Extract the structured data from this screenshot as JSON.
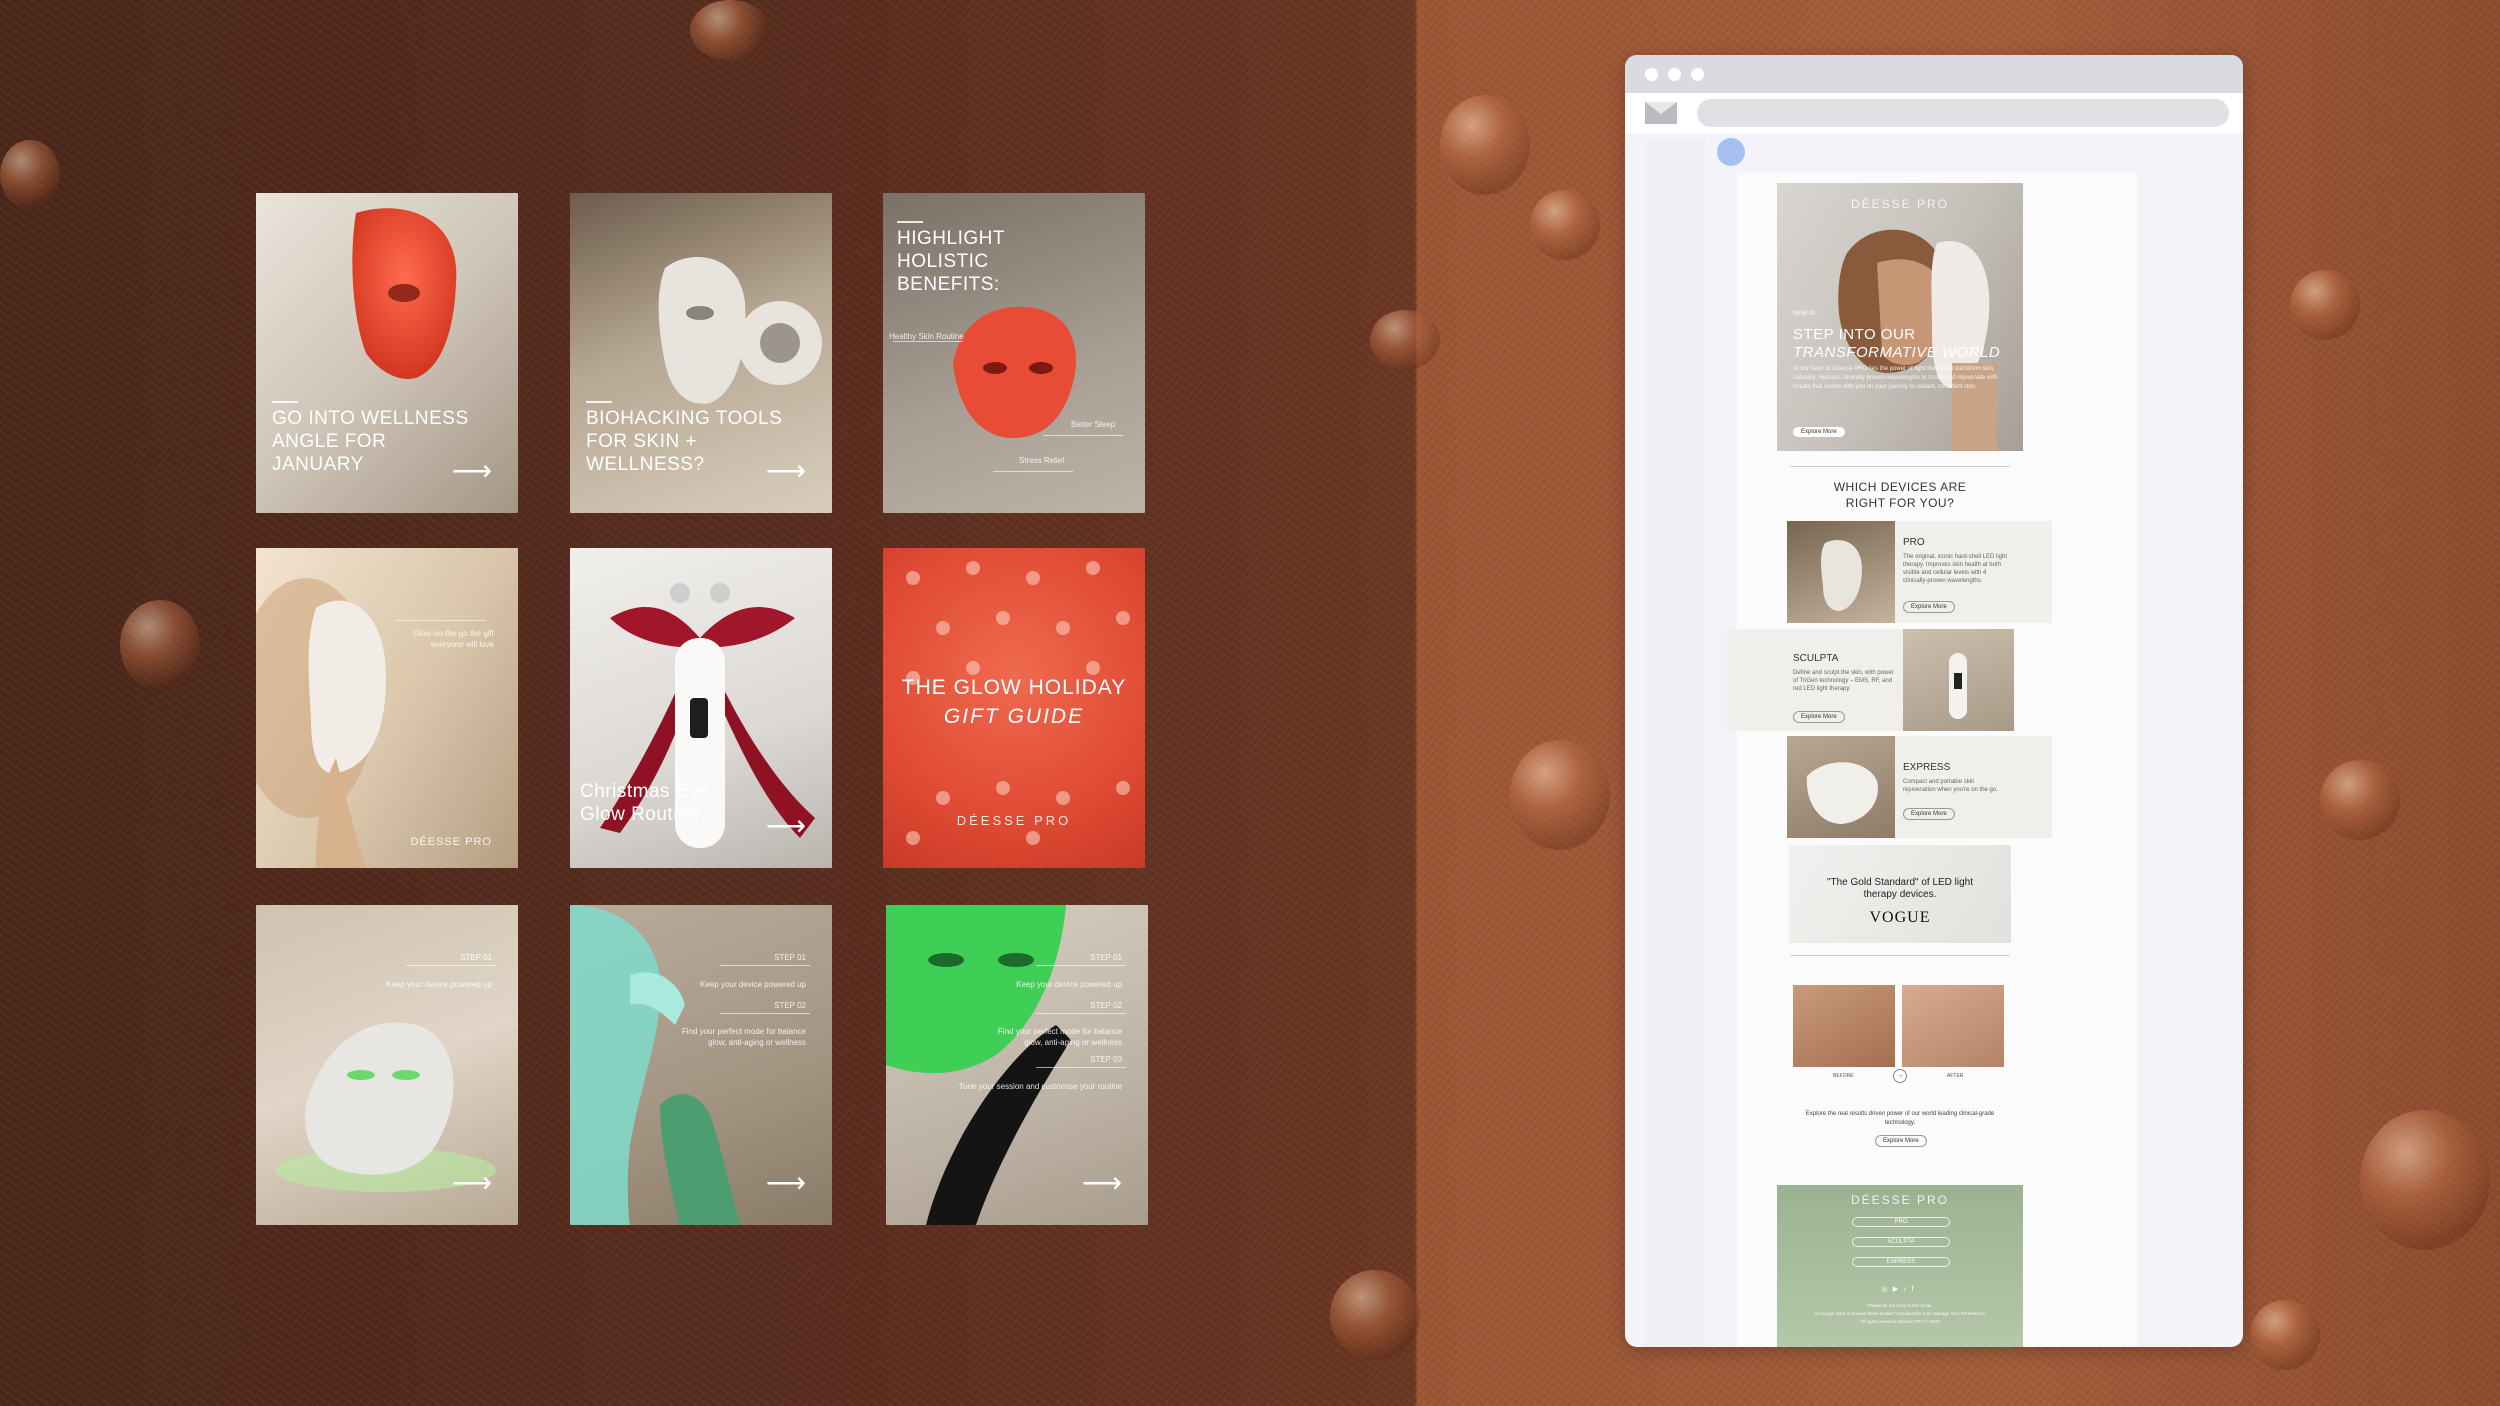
{
  "cards": [
    {
      "title": "GO INTO WELLNESS ANGLE FOR JANUARY"
    },
    {
      "title": "BIOHACKING TOOLS FOR SKIN + WELLNESS?"
    },
    {
      "title": "HIGHLIGHT HOLISTIC BENEFITS:",
      "labels": [
        "Healthy Skin Routine",
        "Better Sleep",
        "Stress Relief"
      ]
    },
    {
      "caption": "Glow on-the-go the gift everyone will love",
      "brand": "DÉESSE PRO"
    },
    {
      "title": "Christmas Eve Glow Routine"
    },
    {
      "title_line1": "THE GLOW HOLIDAY",
      "title_line2": "GIFT GUIDE",
      "brand": "DÉESSE PRO"
    },
    {
      "steps": [
        {
          "label": "STEP 01",
          "text": "Keep your device powered up"
        }
      ]
    },
    {
      "steps": [
        {
          "label": "STEP 01",
          "text": "Keep your device powered up"
        },
        {
          "label": "STEP 02",
          "text": "Find your perfect mode for balance glow, anti-aging or wellness"
        }
      ]
    },
    {
      "steps": [
        {
          "label": "STEP 01",
          "text": "Keep your device powered up"
        },
        {
          "label": "STEP 02",
          "text": "Find your perfect mode for balance glow, anti-aging or wellness"
        },
        {
          "label": "STEP 03",
          "text": "Tune your session and customise your routine"
        }
      ]
    }
  ],
  "email": {
    "brand": "DÉESSE PRO",
    "hero_pretitle": "NEW IN",
    "hero_title_1": "STEP INTO OUR",
    "hero_title_2": "TRANSFORMATIVE WORLD",
    "hero_body": "At the heart of Déesse PRO lies the power of light therapy to transform skin, naturally. Harness clinically proven wavelengths to sculpt and rejuvenate with results that evolve with you on your journey to radiant, confident skin.",
    "hero_button": "Explore More",
    "devices_heading_1": "WHICH DEVICES ARE",
    "devices_heading_2": "RIGHT FOR YOU?",
    "devices": [
      {
        "name": "PRO",
        "desc": "The original, iconic hard-shell LED light therapy. Improves skin health at both visible and cellular levels with 4 clinically-proven wavelengths.",
        "button": "Explore More"
      },
      {
        "name": "SCULPTA",
        "desc": "Define and sculpt the skin, with power of TriGen technology – EMS, RF, and red LED light therapy.",
        "button": "Explore More"
      },
      {
        "name": "EXPRESS",
        "desc": "Compact and portable skin rejuvenation when you're on the go.",
        "button": "Explore More"
      }
    ],
    "quote": "\"The Gold Standard\" of LED light therapy devices.",
    "quote_source": "VOGUE",
    "before_label": "BEFORE",
    "after_label": "AFTER",
    "results_text": "Explore the real results driven power of our world leading clinical-grade technology.",
    "results_button": "Explore More",
    "footer_links": [
      "PRO",
      "SCULPTA",
      "EXPRESS"
    ],
    "footer_small_1": "Please do not reply to this email.",
    "footer_small_2": "No longer want to receive these emails? Unsubscribe from Manage Your Preferences",
    "footer_small_3": "All rights reserved Déesse PRO © 2025"
  },
  "colors": {
    "accent_red": "#e8543c",
    "accent_green": "#46c45a",
    "accent_teal": "#6fd8c4",
    "bow_red": "#a1162a"
  }
}
